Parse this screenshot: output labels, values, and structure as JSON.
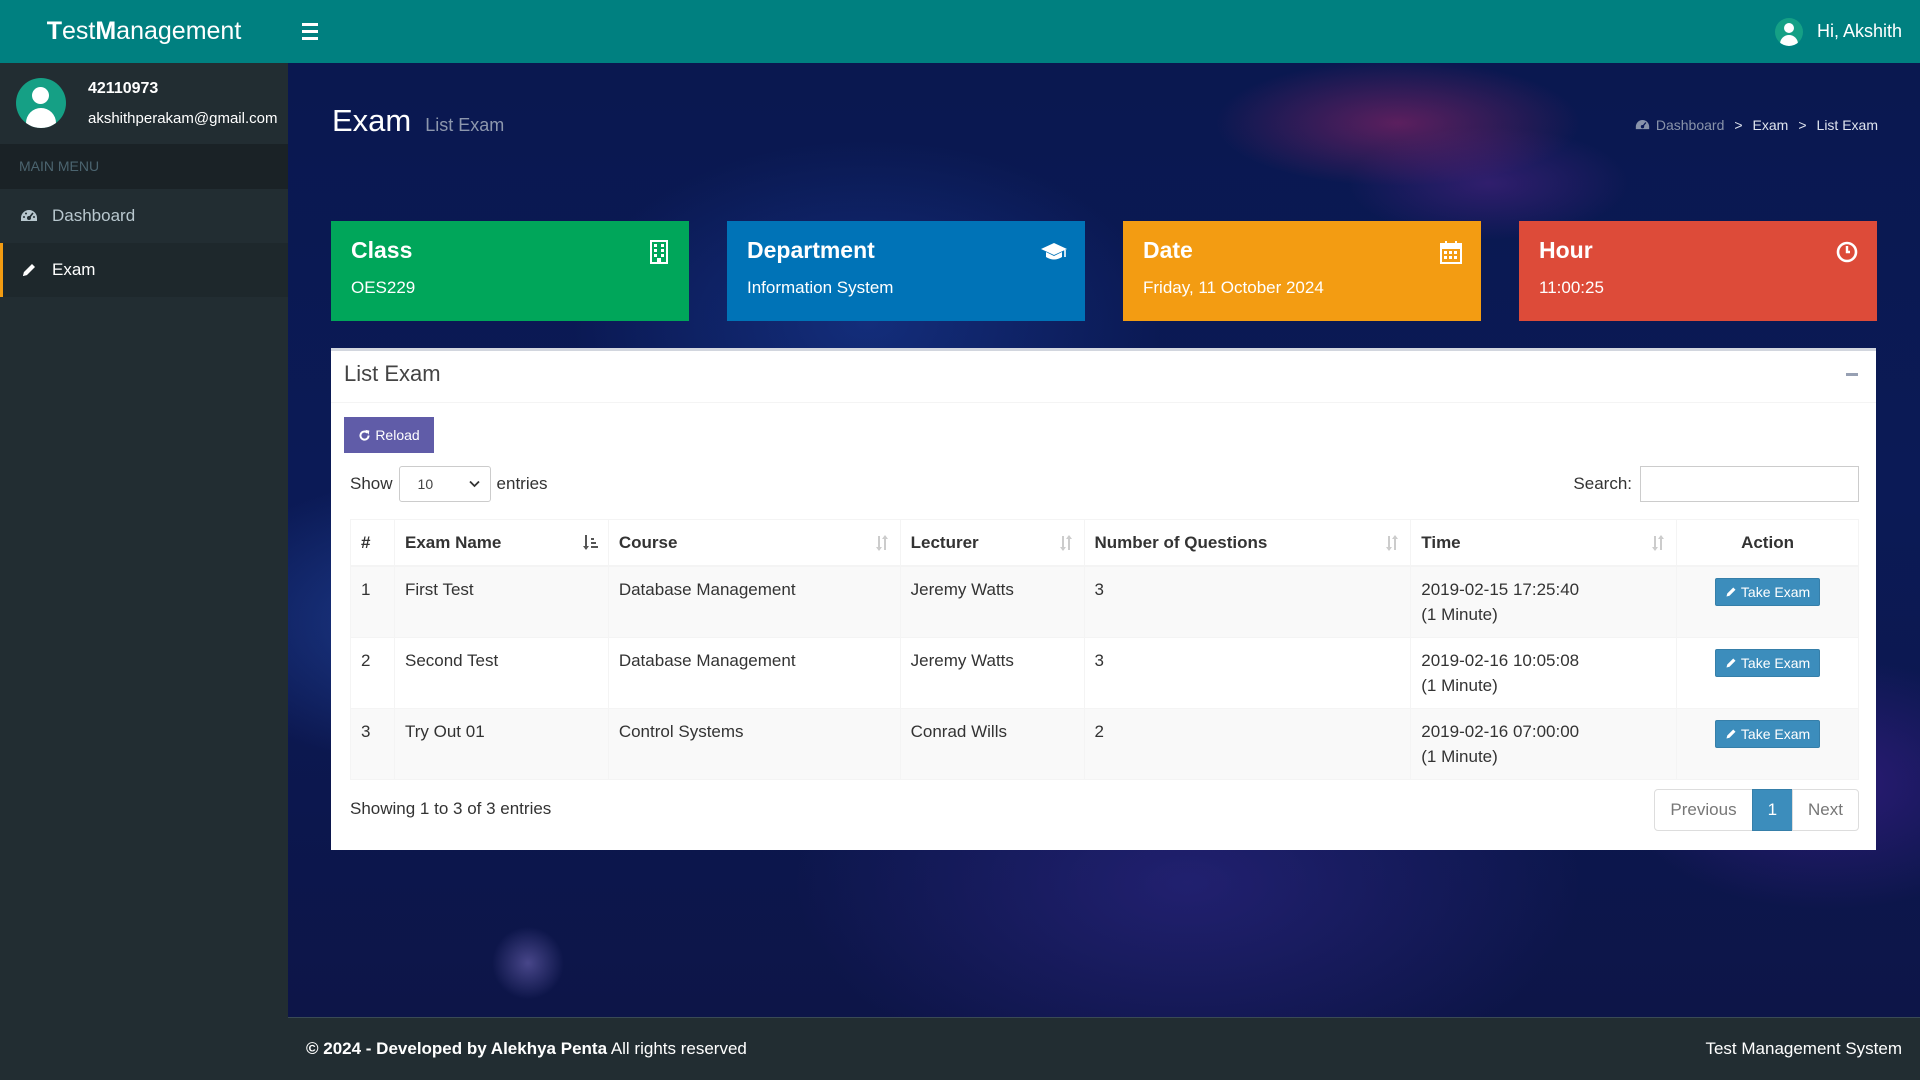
{
  "app": {
    "brand_first": "T",
    "brand_est": "est ",
    "brand_m": "M",
    "brand_rest": "anagement"
  },
  "topbar": {
    "greeting": "Hi, Akshith",
    "menu_icon": "hamburger-icon",
    "user_icon": "user-avatar-icon",
    "color": "#008080"
  },
  "sidebar": {
    "user_id": "42110973",
    "user_email": "akshithperakam@gmail.com",
    "menu_header": "MAIN MENU",
    "items": [
      {
        "label": "Dashboard",
        "icon": "dashboard-icon",
        "active": false
      },
      {
        "label": "Exam",
        "icon": "pencil-icon",
        "active": true
      }
    ]
  },
  "page": {
    "title": "Exam",
    "subtitle": "List Exam",
    "breadcrumb": [
      "Dashboard",
      "Exam",
      "List Exam"
    ],
    "breadcrumb_sep": ">"
  },
  "cards": [
    {
      "title": "Class",
      "value": "OES229",
      "icon": "building-icon",
      "color": "#00a65a"
    },
    {
      "title": "Department",
      "value": "Information System",
      "icon": "graduation-cap-icon",
      "color": "#0073b7"
    },
    {
      "title": "Date",
      "value": "Friday, 11 October 2024",
      "icon": "calendar-icon",
      "color": "#f39c12"
    },
    {
      "title": "Hour",
      "value": "11:00:25",
      "icon": "clock-icon",
      "color": "#dd4b39"
    }
  ],
  "list_box": {
    "title": "List Exam",
    "reload_label": "Reload",
    "show_label": "Show",
    "entries_label": "entries",
    "page_size": "10",
    "search_label": "Search:",
    "search_value": "",
    "columns": [
      "#",
      "Exam Name",
      "Course",
      "Lecturer",
      "Number of Questions",
      "Time",
      "Action"
    ],
    "rows": [
      {
        "no": "1",
        "name": "First Test",
        "course": "Database Management",
        "lecturer": "Jeremy Watts",
        "questions": "3",
        "time": "2019-02-15 17:25:40",
        "duration": "(1 Minute)",
        "action": "Take Exam"
      },
      {
        "no": "2",
        "name": "Second Test",
        "course": "Database Management",
        "lecturer": "Jeremy Watts",
        "questions": "3",
        "time": "2019-02-16 10:05:08",
        "duration": "(1 Minute)",
        "action": "Take Exam"
      },
      {
        "no": "3",
        "name": "Try Out 01",
        "course": "Control Systems",
        "lecturer": "Conrad Wills",
        "questions": "2",
        "time": "2019-02-16 07:00:00",
        "duration": "(1 Minute)",
        "action": "Take Exam"
      }
    ],
    "info": "Showing 1 to 3 of 3 entries",
    "pagination": {
      "previous": "Previous",
      "current": "1",
      "next": "Next"
    }
  },
  "footer": {
    "copyright": "© 2024 - Developed by Alekhya Penta",
    "rights": " All rights reserved",
    "system": "Test Management System"
  }
}
